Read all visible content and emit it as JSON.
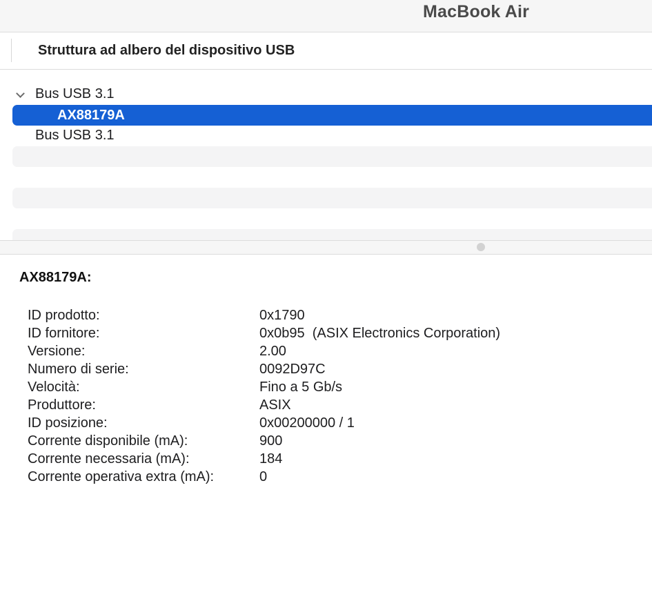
{
  "window": {
    "title": "MacBook Air"
  },
  "tree": {
    "column_header": "Struttura ad albero del dispositivo USB",
    "items": [
      {
        "label": "Bus USB 3.1",
        "expanded": true,
        "level": 0
      },
      {
        "label": "AX88179A",
        "selected": true,
        "level": 1
      },
      {
        "label": "Bus USB 3.1",
        "level": 0
      }
    ]
  },
  "details": {
    "title": "AX88179A:",
    "properties": [
      {
        "key": "ID prodotto:",
        "value": "0x1790"
      },
      {
        "key": "ID fornitore:",
        "value": "0x0b95  (ASIX Electronics Corporation)"
      },
      {
        "key": "Versione:",
        "value": "2.00"
      },
      {
        "key": "Numero di serie:",
        "value": "0092D97C"
      },
      {
        "key": "Velocità:",
        "value": "Fino a 5 Gb/s"
      },
      {
        "key": "Produttore:",
        "value": "ASIX"
      },
      {
        "key": "ID posizione:",
        "value": "0x00200000 / 1"
      },
      {
        "key": "Corrente disponibile (mA):",
        "value": "900"
      },
      {
        "key": "Corrente necessaria (mA):",
        "value": "184"
      },
      {
        "key": "Corrente operativa extra (mA):",
        "value": "0"
      }
    ]
  },
  "colors": {
    "selection": "#1560d4",
    "alternate_row": "#f4f4f5"
  },
  "icons": {
    "disclosure": "chevron-down-icon",
    "splitter": "splitter-handle-icon"
  }
}
